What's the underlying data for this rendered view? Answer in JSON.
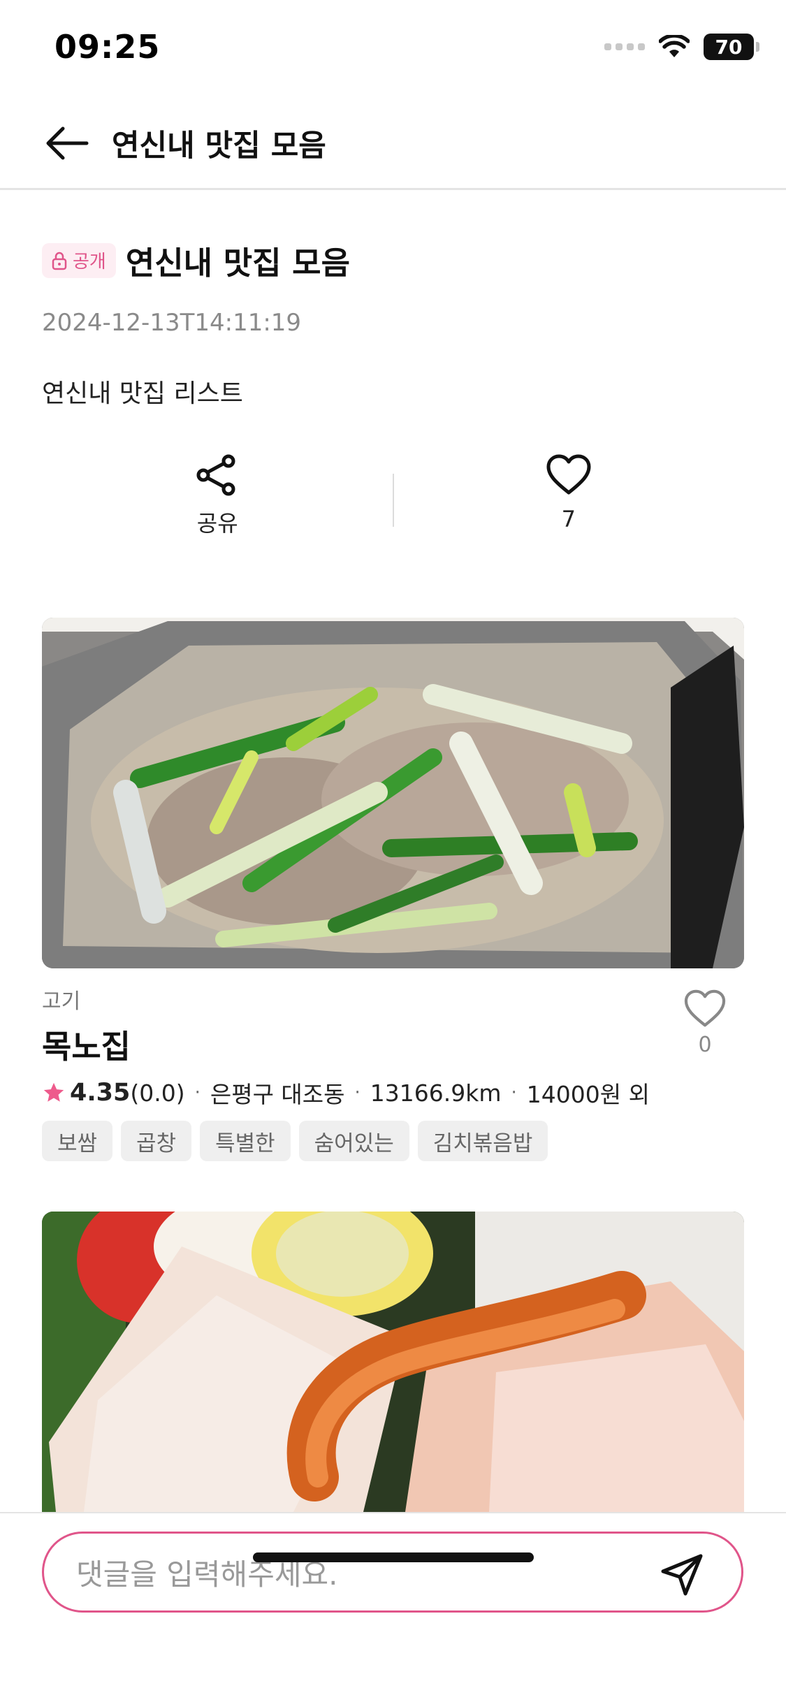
{
  "status_bar": {
    "time": "09:25",
    "battery": "70"
  },
  "header": {
    "title": "연신내 맛집 모음"
  },
  "post": {
    "privacy_label": "공개",
    "title": "연신내 맛집 모음",
    "date": "2024-12-13T14:11:19",
    "description": "연신내 맛집 리스트"
  },
  "actions": {
    "share_label": "공유",
    "like_count": "7"
  },
  "restaurants": [
    {
      "category": "고기",
      "name": "목노집",
      "rating": "4.35",
      "rating_count": "(0.0)",
      "location": "은평구 대조동",
      "distance": "13166.9km",
      "price": "14000원 외",
      "like_count": "0",
      "tags": [
        "보쌈",
        "곱창",
        "특별한",
        "숨어있는",
        "김치볶음밥"
      ]
    }
  ],
  "comment": {
    "placeholder": "댓글을 입력해주세요."
  },
  "colors": {
    "accent": "#e0558a",
    "star": "#ee5b8c"
  }
}
